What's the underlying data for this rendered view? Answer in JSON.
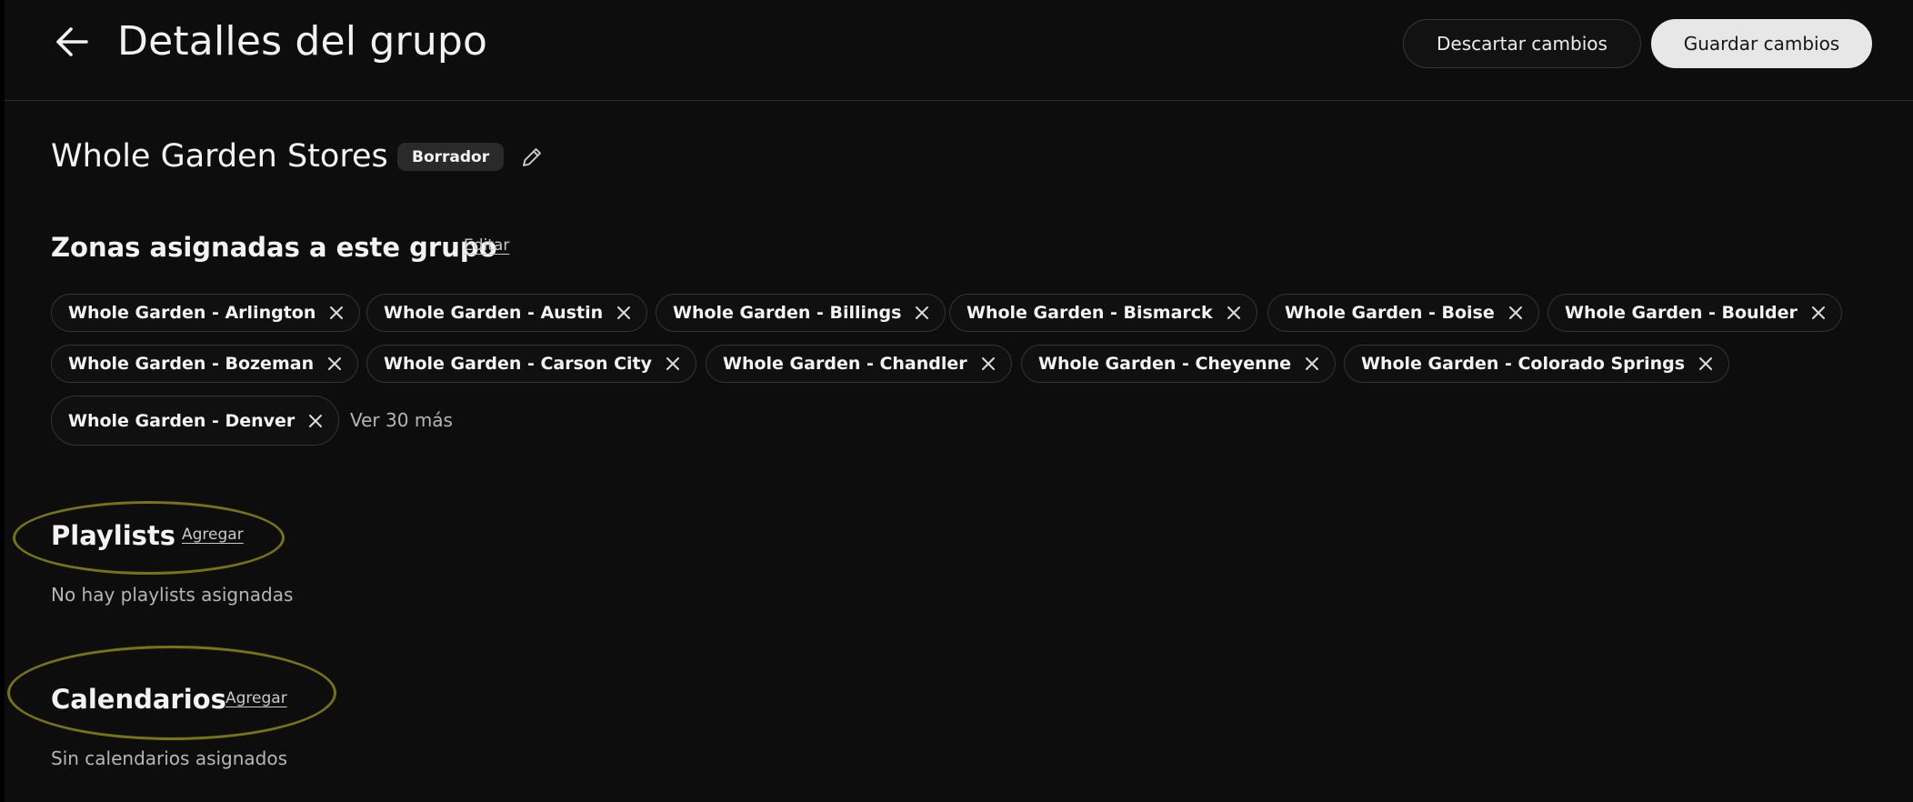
{
  "header": {
    "title": "Detalles del grupo",
    "discard_label": "Descartar cambios",
    "save_label": "Guardar cambios"
  },
  "group": {
    "name": "Whole Garden Stores",
    "status": "Borrador"
  },
  "zones": {
    "title": "Zonas asignadas a este grupo",
    "edit_label": "Editar",
    "chips": [
      "Whole Garden - Arlington",
      "Whole Garden - Austin",
      "Whole Garden - Billings",
      "Whole Garden - Bismarck",
      "Whole Garden - Boise",
      "Whole Garden - Boulder",
      "Whole Garden - Bozeman",
      "Whole Garden - Carson City",
      "Whole Garden - Chandler",
      "Whole Garden - Cheyenne",
      "Whole Garden - Colorado Springs",
      "Whole Garden - Denver"
    ],
    "more_label": "Ver 30 más"
  },
  "playlists": {
    "title": "Playlists",
    "add_label": "Agregar",
    "empty_text": "No hay playlists asignadas"
  },
  "calendars": {
    "title": "Calendarios",
    "add_label": "Agregar",
    "empty_text": "Sin calendarios asignados"
  },
  "icons": {
    "back": "arrow-left-icon",
    "edit": "pencil-icon",
    "remove": "close-icon"
  },
  "colors": {
    "background": "#0d0d0d",
    "highlight": "#787314",
    "save_button": "#e7e7e7"
  }
}
